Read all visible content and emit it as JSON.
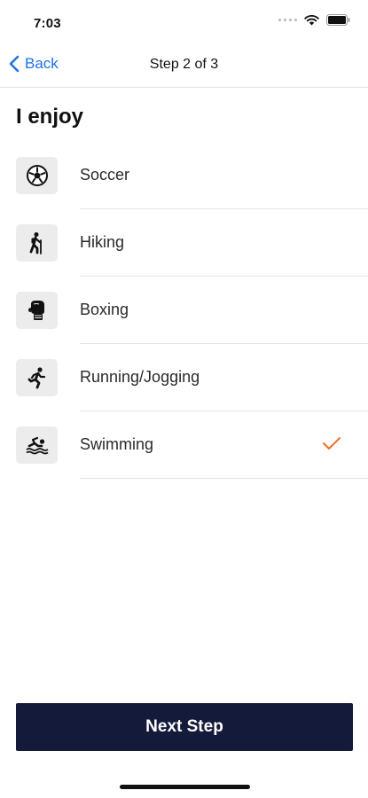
{
  "status_bar": {
    "time": "7:03",
    "icons": [
      "signal-dots-icon",
      "wifi-icon",
      "battery-icon"
    ]
  },
  "nav": {
    "back_label": "Back",
    "title": "Step 2 of 3",
    "back_icon": "chevron-left-icon"
  },
  "heading": "I enjoy",
  "options": [
    {
      "label": "Soccer",
      "icon": "soccer-ball-icon",
      "selected": false
    },
    {
      "label": "Hiking",
      "icon": "hiker-icon",
      "selected": false
    },
    {
      "label": "Boxing",
      "icon": "boxing-glove-icon",
      "selected": false
    },
    {
      "label": "Running/Jogging",
      "icon": "runner-icon",
      "selected": false
    },
    {
      "label": "Swimming",
      "icon": "swimmer-icon",
      "selected": true
    }
  ],
  "next_button": {
    "label": "Next Step"
  },
  "colors": {
    "accent_blue": "#1a73e8",
    "check_orange": "#f26b21",
    "button_navy": "#141a3a",
    "icon_tile": "#ececec"
  }
}
